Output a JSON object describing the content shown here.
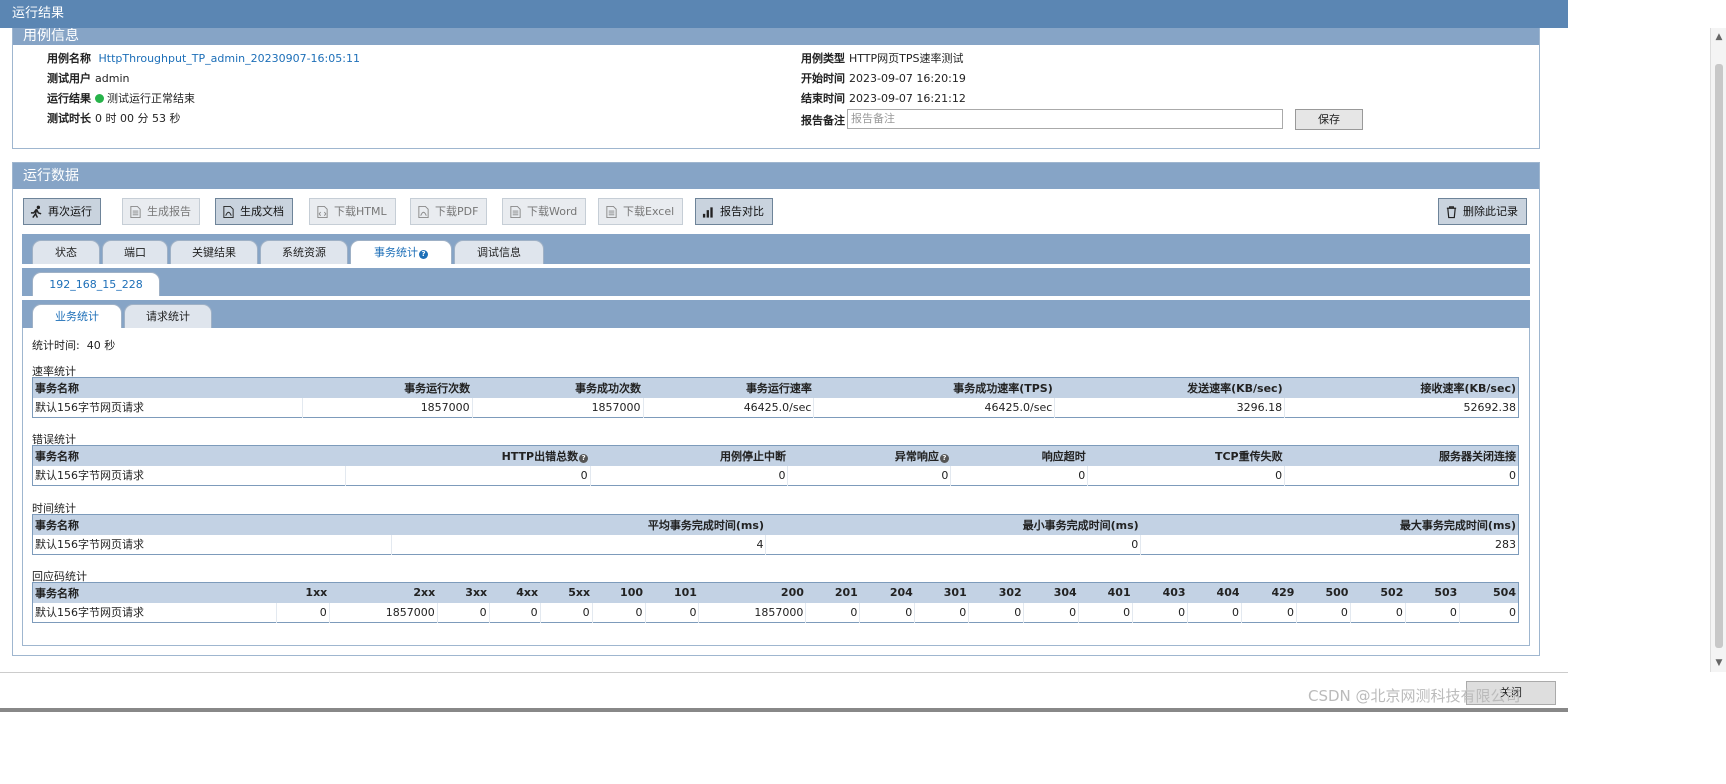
{
  "window": {
    "title": "运行结果"
  },
  "case_info": {
    "header": "用例信息",
    "name_label": "用例名称",
    "name_value": "HttpThroughput_TP_admin_20230907-16:05:11",
    "user_label": "测试用户",
    "user_value": "admin",
    "result_label": "运行结果",
    "result_value": "测试运行正常结束",
    "duration_label": "测试时长",
    "duration_value": "0 时 00 分 53 秒",
    "type_label": "用例类型",
    "type_value": "HTTP网页TPS速率测试",
    "start_label": "开始时间",
    "start_value": "2023-09-07 16:20:19",
    "end_label": "结束时间",
    "end_value": "2023-09-07 16:21:12",
    "note_label": "报告备注",
    "note_placeholder": "报告备注",
    "save_label": "保存",
    "result_color": "#27b34a"
  },
  "run_data": {
    "header": "运行数据",
    "toolbar": {
      "rerun": "再次运行",
      "gen_report": "生成报告",
      "gen_doc": "生成文档",
      "dl_html": "下载HTML",
      "dl_pdf": "下载PDF",
      "dl_word": "下载Word",
      "dl_excel": "下载Excel",
      "compare": "报告对比",
      "delete": "删除此记录"
    },
    "tabs": [
      "状态",
      "端口",
      "关键结果",
      "系统资源",
      "事务统计",
      "调试信息"
    ],
    "active_tab": "事务统计",
    "ip_tab": "192_168_15_228",
    "subtabs": [
      "业务统计",
      "请求统计"
    ],
    "stat_time_label": "统计时间:",
    "stat_time_value": "40 秒"
  },
  "rate_stats": {
    "title": "速率统计",
    "headers": [
      "事务名称",
      "事务运行次数",
      "事务成功次数",
      "事务运行速率",
      "事务成功速率(TPS)",
      "发送速率(KB/sec)",
      "接收速率(KB/sec)"
    ],
    "rows": [
      [
        "默认156字节网页请求",
        "1857000",
        "1857000",
        "46425.0/sec",
        "46425.0/sec",
        "3296.18",
        "52692.38"
      ]
    ]
  },
  "error_stats": {
    "title": "错误统计",
    "headers": [
      "事务名称",
      "HTTP出错总数",
      "用例停止中断",
      "异常响应",
      "响应超时",
      "TCP重传失败",
      "服务器关闭连接"
    ],
    "rows": [
      [
        "默认156字节网页请求",
        "0",
        "0",
        "0",
        "0",
        "0",
        "0"
      ]
    ]
  },
  "time_stats": {
    "title": "时间统计",
    "headers": [
      "事务名称",
      "平均事务完成时间(ms)",
      "最小事务完成时间(ms)",
      "最大事务完成时间(ms)"
    ],
    "rows": [
      [
        "默认156字节网页请求",
        "4",
        "0",
        "283"
      ]
    ]
  },
  "code_stats": {
    "title": "回应码统计",
    "headers": [
      "事务名称",
      "1xx",
      "2xx",
      "3xx",
      "4xx",
      "5xx",
      "100",
      "101",
      "200",
      "201",
      "204",
      "301",
      "302",
      "304",
      "401",
      "403",
      "404",
      "429",
      "500",
      "502",
      "503",
      "504"
    ],
    "rows": [
      [
        "默认156字节网页请求",
        "0",
        "1857000",
        "0",
        "0",
        "0",
        "0",
        "0",
        "1857000",
        "0",
        "0",
        "0",
        "0",
        "0",
        "0",
        "0",
        "0",
        "0",
        "0",
        "0",
        "0",
        "0"
      ]
    ]
  },
  "footer": {
    "close_label": "关闭",
    "watermark": "CSDN @北京网测科技有限公司"
  }
}
